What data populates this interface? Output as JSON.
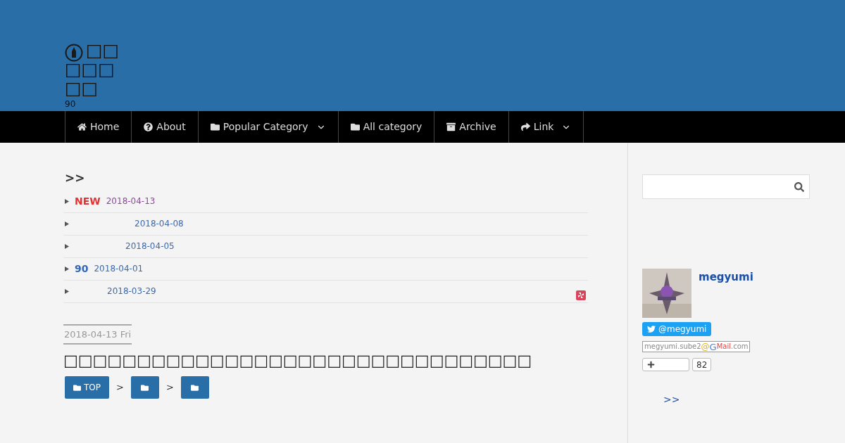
{
  "site": {
    "title": "□□□□□□□",
    "subtitle": "90"
  },
  "nav": [
    {
      "label": "Home",
      "dropdown": false
    },
    {
      "label": "About",
      "dropdown": false
    },
    {
      "label": "Popular Category",
      "dropdown": true
    },
    {
      "label": "All category",
      "dropdown": false
    },
    {
      "label": "Archive",
      "dropdown": false
    },
    {
      "label": "Link",
      "dropdown": true
    }
  ],
  "recent": {
    "heading": ">>",
    "items": [
      {
        "kind": "new",
        "badge": "NEW",
        "date": "2018-04-13",
        "visited": true
      },
      {
        "kind": "plain",
        "date": "2018-04-08",
        "visited": false
      },
      {
        "kind": "plain",
        "date": "2018-04-05",
        "visited": false
      },
      {
        "kind": "count",
        "badge": "90",
        "date": "2018-04-01",
        "visited": false
      },
      {
        "kind": "plain",
        "date": "2018-03-29",
        "visited": false
      }
    ]
  },
  "post": {
    "date": "2018-04-13 Fri",
    "title": "□□□□□□□□□□□□□□□□□□□□□□□□□□□□□□□□",
    "breadcrumbs": [
      {
        "kind": "labeled",
        "label": "TOP"
      },
      {
        "kind": "icon"
      },
      {
        "kind": "icon"
      }
    ],
    "separator": ">"
  },
  "sidebar": {
    "profile": {
      "name": "megyumi",
      "twitter": "@megyumi",
      "email_user": "megyumi.sube2",
      "email_at": "@",
      "email_g": "G",
      "email_mail": "Mail",
      "email_domain": ".com",
      "follow_count": "82"
    },
    "more": ">>"
  }
}
